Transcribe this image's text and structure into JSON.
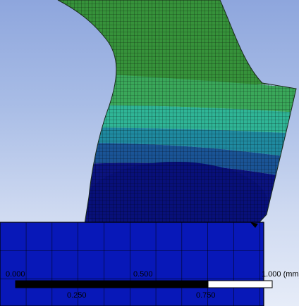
{
  "viewport": {
    "label": "FEA mesh deformation contour view"
  },
  "colors": {
    "background_top": "#8ea6dd",
    "background_bottom": "#e6ecf8",
    "contour_bands": [
      "#0a0f7a",
      "#1a3d8f",
      "#1e7a9a",
      "#2fa88f",
      "#3fb06a",
      "#3f9a3a",
      "#2f7f2a"
    ],
    "base_plate": "#0818b8",
    "mesh_line": "#000000"
  },
  "scale_bar": {
    "tick_left": "0.000",
    "tick_mid": "0.500",
    "tick_right": "1.000 (mm)",
    "sub_left": "0.250",
    "sub_right": "0.750"
  }
}
